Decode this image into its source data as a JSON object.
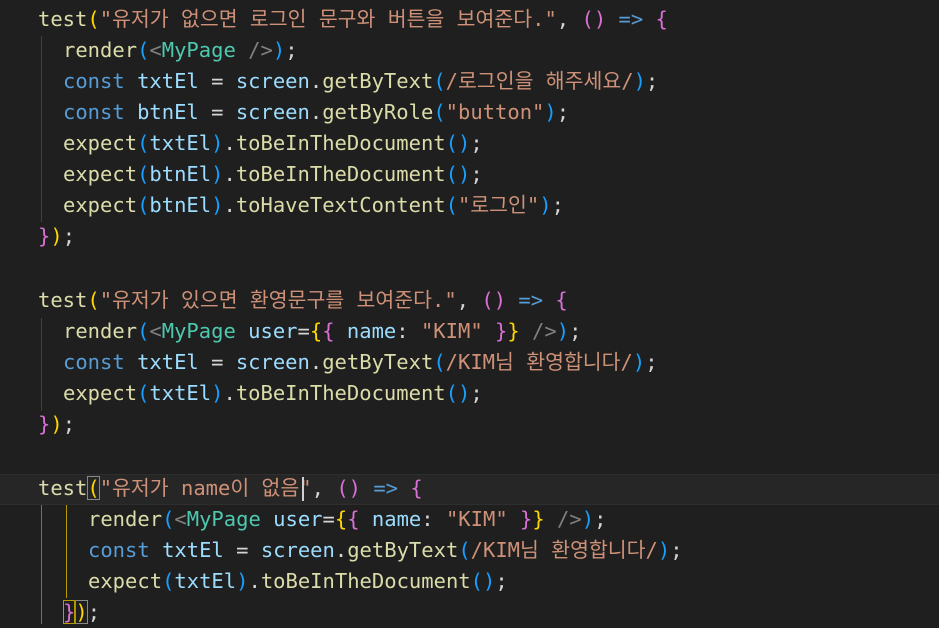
{
  "editor": {
    "blocks": [
      {
        "test_keyword": "test",
        "test_title": "\"유저가 없으면 로그인 문구와 버튼을 보여준다.\"",
        "lines": [
          "render(<MyPage />);",
          "const txtEl = screen.getByText(/로그인을 해주세요/);",
          "const btnEl = screen.getByRole(\"button\");",
          "expect(txtEl).toBeInTheDocument();",
          "expect(btnEl).toBeInTheDocument();",
          "expect(btnEl).toHaveTextContent(\"로그인\");"
        ],
        "closing": "});"
      },
      {
        "test_keyword": "test",
        "test_title": "\"유저가 있으면 환영문구를 보여준다.\"",
        "lines": [
          "render(<MyPage user={{ name: \"KIM\" }} />);",
          "const txtEl = screen.getByText(/KIM님 환영합니다/);",
          "expect(txtEl).toBeInTheDocument();"
        ],
        "closing": "});"
      },
      {
        "test_keyword": "test",
        "test_title": "\"유저가 name이 없음\"",
        "lines": [
          "render(<MyPage user={{ name: \"KIM\" }} />);",
          "const txtEl = screen.getByText(/KIM님 환영합니다/);",
          "expect(txtEl).toBeInTheDocument();"
        ],
        "closing": "});"
      }
    ]
  }
}
